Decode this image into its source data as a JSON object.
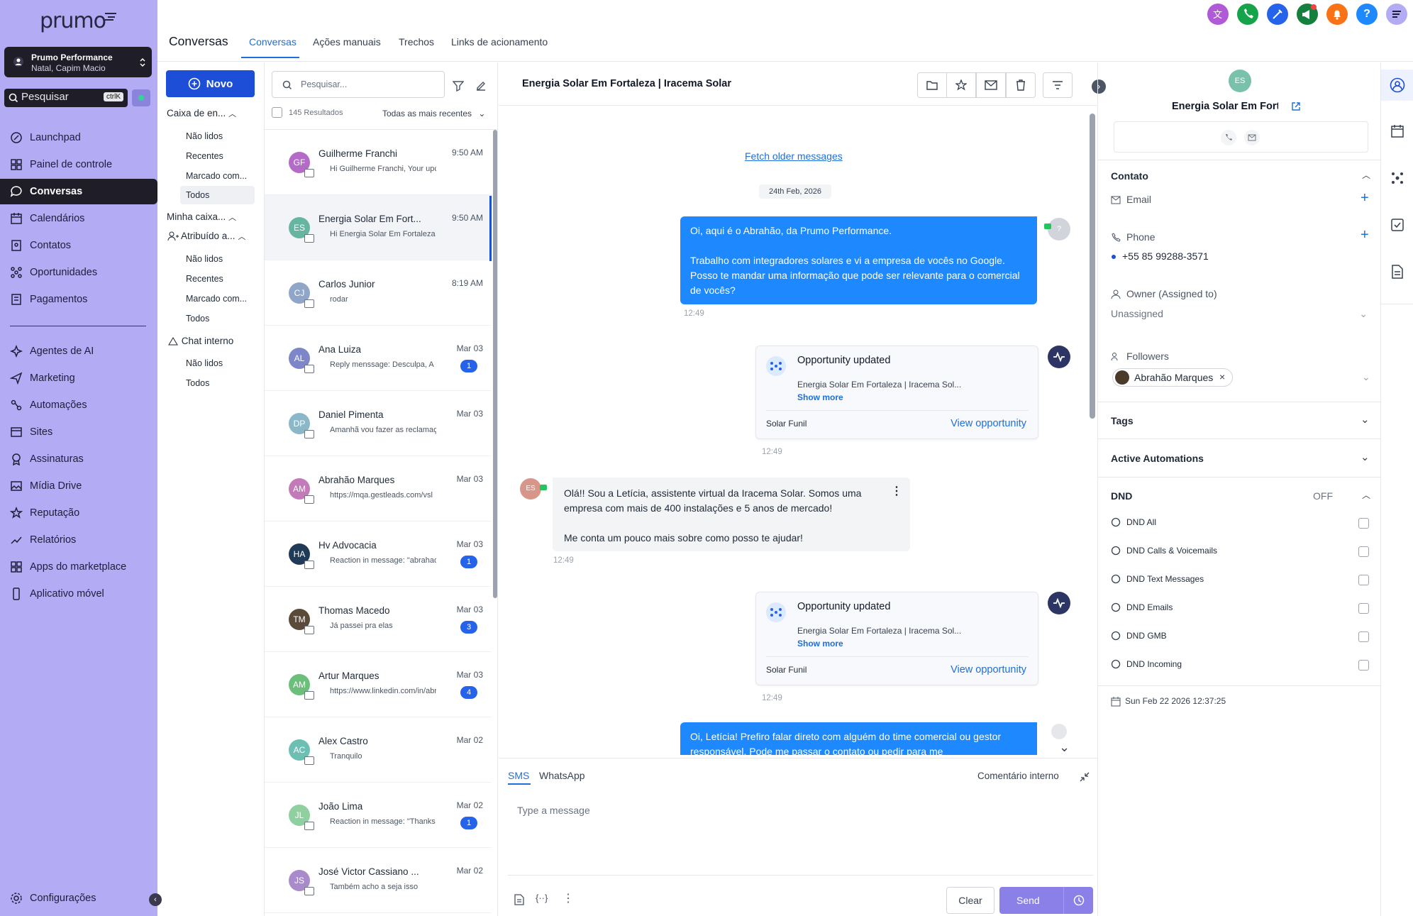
{
  "app": {
    "logo": "prumo"
  },
  "location": {
    "name": "Prumo Performance",
    "sub": "Natal, Capim Macio"
  },
  "search": {
    "label": "Pesquisar",
    "shortcut": "ctrlK"
  },
  "nav": [
    {
      "label": "Launchpad",
      "icon": "rocket-icon"
    },
    {
      "label": "Painel de controle",
      "icon": "grid-icon"
    },
    {
      "label": "Conversas",
      "icon": "chat-icon",
      "active": true
    },
    {
      "label": "Calendários",
      "icon": "calendar-icon"
    },
    {
      "label": "Contatos",
      "icon": "contacts-icon"
    },
    {
      "label": "Oportunidades",
      "icon": "opportunities-icon"
    },
    {
      "label": "Pagamentos",
      "icon": "payments-icon"
    }
  ],
  "nav2": [
    {
      "label": "Agentes de AI",
      "icon": "sparkle-icon"
    },
    {
      "label": "Marketing",
      "icon": "send-icon"
    },
    {
      "label": "Automações",
      "icon": "automation-icon"
    },
    {
      "label": "Sites",
      "icon": "sites-icon"
    },
    {
      "label": "Assinaturas",
      "icon": "badge-icon"
    },
    {
      "label": "Mídia Drive",
      "icon": "image-icon"
    },
    {
      "label": "Reputação",
      "icon": "star-icon"
    },
    {
      "label": "Relatórios",
      "icon": "chart-icon"
    },
    {
      "label": "Apps do marketplace",
      "icon": "apps-icon"
    },
    {
      "label": "Aplicativo móvel",
      "icon": "mobile-icon"
    }
  ],
  "settings": {
    "label": "Configurações"
  },
  "page": {
    "title": "Conversas"
  },
  "tabs": [
    "Conversas",
    "Ações manuais",
    "Trechos",
    "Links de acionamento"
  ],
  "filters": {
    "new_button": "Novo",
    "inbox": "Caixa de en...",
    "inbox_items": [
      "Não lidos",
      "Recentes",
      "Marcado com...",
      "Todos"
    ],
    "my_inbox": "Minha caixa...",
    "assigned": "Atribuído a...",
    "assigned_items": [
      "Não lidos",
      "Recentes",
      "Marcado com...",
      "Todos"
    ],
    "internal": "Chat interno",
    "internal_items": [
      "Não lidos",
      "Todos"
    ]
  },
  "list": {
    "search_placeholder": "Pesquisar...",
    "results": "145 Resultados",
    "sort": "Todas as mais recentes",
    "conversations": [
      {
        "initials": "GF",
        "name": "Guilherme Franchi",
        "preview": "Hi Guilherme Franchi, Your upcor",
        "time": "9:50 AM",
        "color": "#b36bc7",
        "badge": ""
      },
      {
        "initials": "ES",
        "name": "Energia Solar Em Fort...",
        "preview": "Hi Energia Solar Em Fortaleza | Ir",
        "time": "9:50 AM",
        "color": "#66b5a1",
        "badge": ""
      },
      {
        "initials": "CJ",
        "name": "Carlos Junior",
        "preview": "rodar",
        "time": "8:19 AM",
        "color": "#8fa6c8",
        "badge": ""
      },
      {
        "initials": "AL",
        "name": "Ana Luiza",
        "preview": "Reply menssage: Desculpa, A",
        "time": "Mar 03",
        "color": "#7c86c9",
        "badge": "1"
      },
      {
        "initials": "DP",
        "name": "Daniel Pimenta",
        "preview": "Amanhã vou fazer as reclamaçõe",
        "time": "Mar 03",
        "color": "#8bb8c9",
        "badge": ""
      },
      {
        "initials": "AM",
        "name": "Abrahão Marques",
        "preview": "https://mqa.gestleads.com/vsl",
        "time": "Mar 03",
        "color": "#c37ab8",
        "badge": ""
      },
      {
        "initials": "HA",
        "name": "Hv Advocacia",
        "preview": "Reaction in message: \"abrahaoma",
        "time": "Mar 03",
        "color": "#1f3b57",
        "badge": "1"
      },
      {
        "initials": "TM",
        "name": "Thomas Macedo",
        "preview": "Já passei pra elas",
        "time": "Mar 03",
        "color": "#5a4a3a",
        "badge": "3"
      },
      {
        "initials": "AM",
        "name": "Artur Marques",
        "preview": "https://www.linkedin.com/in/abra",
        "time": "Mar 03",
        "color": "#6cbf7a",
        "badge": "4"
      },
      {
        "initials": "AC",
        "name": "Alex Castro",
        "preview": "Tranquilo",
        "time": "Mar 02",
        "color": "#6cbfb3",
        "badge": ""
      },
      {
        "initials": "JL",
        "name": "João Lima",
        "preview": "Reaction in message: \"Thanks jau",
        "time": "Mar 02",
        "color": "#8fcfa0",
        "badge": "1"
      },
      {
        "initials": "JS",
        "name": "José Victor Cassiano ...",
        "preview": "Também acho a seja isso",
        "time": "Mar 02",
        "color": "#a98acb",
        "badge": ""
      }
    ]
  },
  "chat": {
    "title": "Energia Solar Em Fortaleza | Iracema Solar",
    "fetch_older": "Fetch older messages",
    "date": "24th Feb, 2026",
    "msg1": {
      "line1": "Oi, aqui é o Abrahão, da Prumo Performance.",
      "line2": "Trabalho com integradores solares e vi a empresa de vocês no Google. Posso te mandar uma informação que pode ser relevante para o comercial de vocês?",
      "time": "12:49"
    },
    "opp1": {
      "title": "Opportunity updated",
      "contact": "Energia Solar Em Fortaleza | Iracema Sol...",
      "show_more": "Show more",
      "pipeline": "Solar Funil",
      "link": "View opportunity",
      "time": "12:49"
    },
    "msg2": {
      "avatar": "ES",
      "line1": "Olá!! Sou a Letícia, assistente virtual da Iracema Solar. Somos uma empresa com mais de 400 instalações e 5 anos de mercado!",
      "line2": "Me conta um pouco mais sobre como posso te ajudar!",
      "time": "12:49"
    },
    "opp2": {
      "title": "Opportunity updated",
      "contact": "Energia Solar Em Fortaleza | Iracema Sol...",
      "show_more": "Show more",
      "pipeline": "Solar Funil",
      "link": "View opportunity",
      "time": "12:49"
    },
    "msg3": {
      "text": "Oi, Letícia! Prefiro falar direto com alguém do time comercial ou gestor responsável. Pode me passar o contato ou pedir para me"
    },
    "composer": {
      "tab_sms": "SMS",
      "tab_whatsapp": "WhatsApp",
      "internal": "Comentário interno",
      "placeholder": "Type a message",
      "clear": "Clear",
      "send": "Send"
    }
  },
  "contact": {
    "initials": "ES",
    "name": "Energia Solar Em Fortale",
    "section": "Contato",
    "email_label": "Email",
    "phone_label": "Phone",
    "phone": "+55 85 99288-3571",
    "owner_label": "Owner (Assigned to)",
    "owner_value": "Unassigned",
    "followers_label": "Followers",
    "follower": "Abrahão Marques",
    "tags": "Tags",
    "automations": "Active Automations",
    "dnd": "DND",
    "dnd_state": "OFF",
    "dnd_items": [
      "DND All",
      "DND Calls & Voicemails",
      "DND Text Messages",
      "DND Emails",
      "DND GMB",
      "DND Incoming"
    ],
    "timestamp": "Sun Feb 22 2026 12:37:25"
  },
  "colors": {
    "sidebar": "#b3acf5",
    "primary": "#1d4ed8",
    "bubble": "#1e88ff",
    "send": "#8b7fe8"
  }
}
